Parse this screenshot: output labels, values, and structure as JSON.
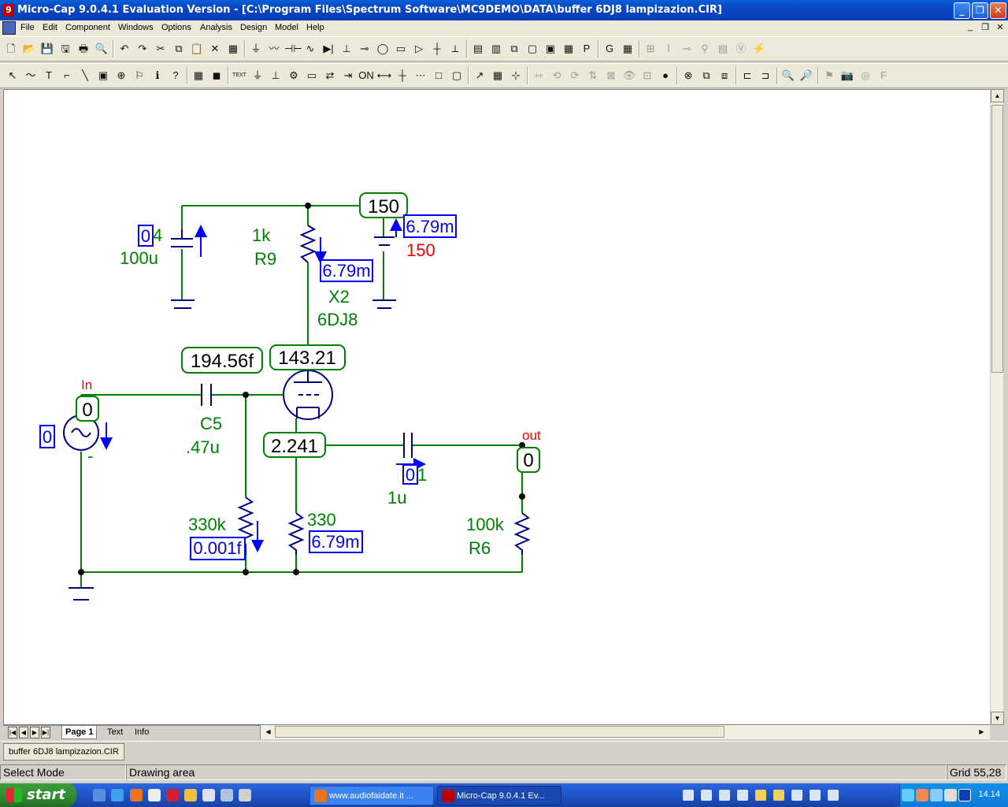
{
  "window": {
    "title": "Micro-Cap 9.0.4.1 Evaluation Version - [C:\\Program Files\\Spectrum Software\\MC9DEMO\\DATA\\buffer 6DJ8 lampizazion.CIR]",
    "app_icon": "9",
    "minimize": "_",
    "maximize": "❐",
    "close": "✕"
  },
  "menu": {
    "items": [
      "File",
      "Edit",
      "Component",
      "Windows",
      "Options",
      "Analysis",
      "Design",
      "Model",
      "Help"
    ],
    "mdi_controls": [
      "_",
      "❐",
      "✕"
    ]
  },
  "toolbar1": {
    "buttons": [
      "new-icon",
      "open-icon",
      "save-icon",
      "save-all-icon",
      "print-icon",
      "print-preview-icon",
      "undo-icon",
      "redo-icon",
      "cut-icon",
      "copy-icon",
      "paste-icon",
      "delete-icon",
      "select-all-icon",
      "ground-icon",
      "wire-resistor-icon",
      "capacitor-icon",
      "inductor-icon",
      "diode-icon",
      "battery-icon",
      "npn-icon",
      "source-icon",
      "ic-icon",
      "opamp-icon",
      "junction-icon",
      "switch-icon",
      "schematic-icon",
      "split-icon",
      "cascade-icon",
      "tile-icon",
      "frame-icon",
      "calculator-icon",
      "p-icon",
      "g-icon",
      "grid-view-icon",
      "pin-icon",
      "wave-icon",
      "step-icon",
      "probe-icon",
      "tape-icon",
      "vdd-icon",
      "chart-icon"
    ],
    "glyphs": [
      "🗋",
      "📂",
      "💾",
      "🖫",
      "🖶",
      "🔍",
      "↶",
      "↷",
      "✂",
      "⧉",
      "📋",
      "✕",
      "▦",
      "⏚",
      "〰",
      "⊣⊢",
      "∿",
      "▶|",
      "⊥",
      "⊸",
      "◯",
      "▭",
      "▷",
      "┼",
      "⟂",
      "▤",
      "▥",
      "⧉",
      "▢",
      "▣",
      "▦",
      "P",
      "G",
      "▦",
      "⊞",
      "⌇",
      "⊸",
      "⚲",
      "▤",
      "Ⓥ",
      "⚡"
    ]
  },
  "toolbar2": {
    "glyphs": [
      "↖",
      "〜",
      "T",
      "⌐",
      "╲",
      "▣",
      "⊕",
      "⚐",
      "ℹ",
      "?",
      "▦",
      "◼",
      "TEXT",
      "⏚",
      "⊥",
      "⚙",
      "▭",
      "⇄",
      "⇥",
      "ON",
      "⟷",
      "┼",
      "⋯",
      "□",
      "▢",
      "↗",
      "▦",
      "⊹",
      "⇿",
      "⟲",
      "⟳",
      "⇅",
      "⊠",
      "👁",
      "⊡",
      "●",
      "⊗",
      "⧉",
      "⧈",
      "⊏",
      "⊐",
      "🔍",
      "🔎",
      "⚑",
      "📷",
      "◎",
      "F"
    ]
  },
  "tabs": {
    "nav": [
      "|◀",
      "◀",
      "▶",
      "▶|"
    ],
    "items": [
      "Page 1",
      "Text",
      "Info"
    ]
  },
  "doc_tab": "buffer 6DJ8 lampizazion.CIR",
  "status": {
    "mode": "Select Mode",
    "area": "Drawing area",
    "grid": "Grid 55,28"
  },
  "schematic": {
    "colors": {
      "wire": "#008000",
      "component": "#000080",
      "label": "#008000",
      "current": "#0000ff",
      "node": "#ff0000",
      "voltage_box": "#008000"
    },
    "voltage_labels": [
      {
        "id": "v150",
        "text": "150"
      },
      {
        "id": "v194",
        "text": "194.56f"
      },
      {
        "id": "v143",
        "text": "143.21"
      },
      {
        "id": "vin",
        "text": "0"
      },
      {
        "id": "v2241",
        "text": "2.241"
      },
      {
        "id": "vout",
        "text": "0"
      }
    ],
    "current_labels": [
      {
        "id": "ic1",
        "text": "0"
      },
      {
        "id": "ir9",
        "text": "6.79m"
      },
      {
        "id": "ibat",
        "text": "6.79m"
      },
      {
        "id": "isrc",
        "text": "0"
      },
      {
        "id": "icout",
        "text": "0"
      },
      {
        "id": "ir330k",
        "text": "0.001f"
      },
      {
        "id": "ir330",
        "text": "6.79m"
      }
    ],
    "component_labels": {
      "c1_overlap": "4",
      "c1_value": "100u",
      "r9_value": "1k",
      "r9_name": "R9",
      "bat_value": "150",
      "x2_name": "X2",
      "x2_model": "6DJ8",
      "c5_name": "C5",
      "c5_value": ".47u",
      "cout_overlap": "1",
      "cout_value": "1u",
      "r330k_value": "330k",
      "r330_value": "330",
      "r6_value": "100k",
      "r6_name": "R6",
      "src_minus": "-"
    },
    "node_names": {
      "in": "In",
      "out": "out"
    }
  },
  "taskbar": {
    "start": "start",
    "tasks": [
      {
        "label": "www.audiofaidate.it ...",
        "icon_color": "#e8741f"
      },
      {
        "label": "Micro-Cap 9.0.4.1 Ev...",
        "icon_color": "#c00000"
      }
    ],
    "clock": "14.14"
  }
}
